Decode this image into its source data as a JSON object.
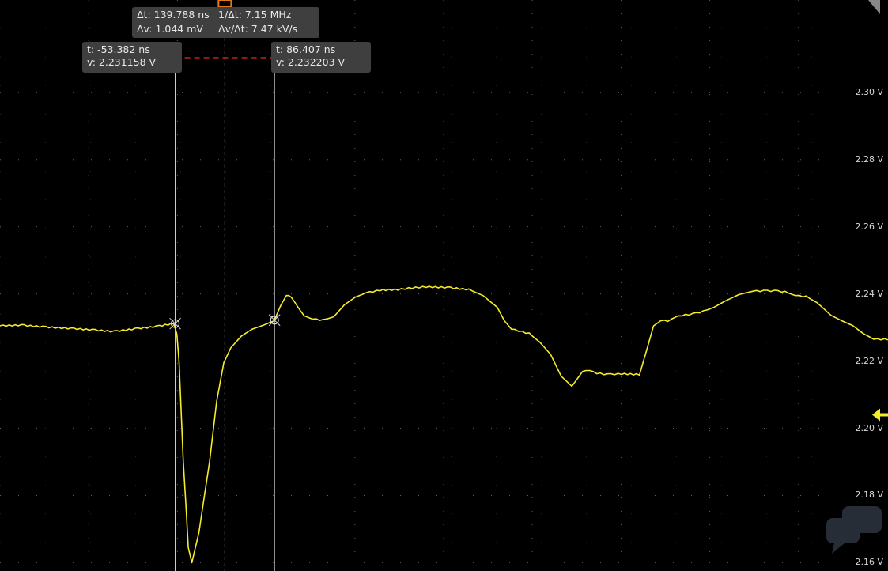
{
  "colors": {
    "background": "#000000",
    "trace": "#f5ec28",
    "grid": "#6a6a6a",
    "cursor": "#d9d9d9",
    "delta_marker": "#e0282a",
    "readout_bg": "#3f3f3f",
    "reference_marker": "#f5ec28"
  },
  "readouts": {
    "cursor1": {
      "time": "t: -53.382 ns",
      "voltage": "v: 2.231158 V"
    },
    "cursor2": {
      "time": "t: 86.407 ns",
      "voltage": "v: 2.232203 V"
    },
    "delta": {
      "dt": "Δt: 139.788 ns",
      "dv": "Δv: 1.044 mV",
      "inv_dt": "1/Δt: 7.15 MHz",
      "dv_dt": "Δv/Δt: 7.47 kV/s"
    }
  },
  "icons": {
    "reference_level": "left-arrow-icon",
    "cursor_marker": "crosshair-icon",
    "watermark": "chat-bubble-icon"
  },
  "chart_data": {
    "type": "line",
    "title": "",
    "xlabel": "",
    "ylabel": "",
    "xlim": [
      -300,
      950
    ],
    "ylim": [
      2.1575,
      2.3275
    ],
    "y_ticks": [
      {
        "value": 2.3,
        "label": "2.30 V"
      },
      {
        "value": 2.28,
        "label": "2.28 V"
      },
      {
        "value": 2.26,
        "label": "2.26 V"
      },
      {
        "value": 2.24,
        "label": "2.24 V"
      },
      {
        "value": 2.22,
        "label": "2.22 V"
      },
      {
        "value": 2.2,
        "label": "2.20 V"
      },
      {
        "value": 2.18,
        "label": "2.18 V"
      },
      {
        "value": 2.16,
        "label": "2.16 V"
      }
    ],
    "grid": true,
    "cursors": [
      {
        "name": "cursor1",
        "t": -53.382,
        "v": 2.231158
      },
      {
        "name": "cursor2",
        "t": 86.407,
        "v": 2.232203
      }
    ],
    "reference_level": 2.204,
    "series": [
      {
        "x": [
          -300,
          -270,
          -240,
          -200,
          -170,
          -140,
          -110,
          -80,
          -55,
          -51,
          -48,
          -45,
          -42,
          -38,
          -35,
          -30,
          -20,
          -5,
          5,
          15,
          25,
          40,
          55,
          72,
          86,
          95,
          103,
          110,
          118,
          128,
          140,
          155,
          170,
          185,
          200,
          215,
          235,
          260,
          280,
          300,
          330,
          360,
          380,
          400,
          410,
          420,
          430,
          445,
          460,
          475,
          490,
          505,
          520,
          525,
          530,
          540,
          555,
          575,
          600,
          610,
          620,
          630,
          640,
          650,
          660,
          675,
          690,
          705,
          720,
          740,
          760,
          775,
          790,
          805,
          820,
          835,
          850,
          870,
          885,
          900,
          915,
          930,
          950
        ],
        "y": [
          2.2305,
          2.2307,
          2.2302,
          2.2297,
          2.2293,
          2.2288,
          2.2296,
          2.2303,
          2.2312,
          2.228,
          2.22,
          2.205,
          2.19,
          2.176,
          2.1645,
          2.16,
          2.169,
          2.19,
          2.208,
          2.2195,
          2.224,
          2.2275,
          2.2295,
          2.2308,
          2.232,
          2.2365,
          2.2395,
          2.2392,
          2.2365,
          2.2335,
          2.2325,
          2.2322,
          2.2332,
          2.2368,
          2.239,
          2.2403,
          2.2411,
          2.2413,
          2.2418,
          2.2421,
          2.2419,
          2.2413,
          2.2395,
          2.236,
          2.232,
          2.2295,
          2.229,
          2.2282,
          2.2256,
          2.222,
          2.2155,
          2.2125,
          2.2169,
          2.217,
          2.217,
          2.2164,
          2.216,
          2.2162,
          2.216,
          2.223,
          2.2305,
          2.232,
          2.232,
          2.233,
          2.2336,
          2.234,
          2.2348,
          2.236,
          2.2378,
          2.2398,
          2.2408,
          2.2409,
          2.2409,
          2.2406,
          2.2395,
          2.2392,
          2.2374,
          2.2336,
          2.232,
          2.2306,
          2.2282,
          2.2265,
          2.2265
        ]
      }
    ]
  }
}
